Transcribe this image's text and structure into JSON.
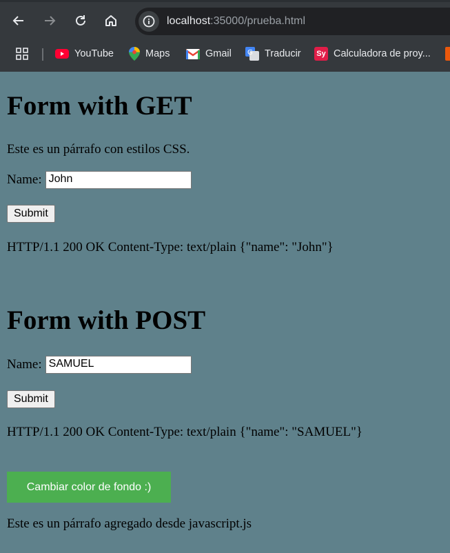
{
  "browser": {
    "url_host": "localhost",
    "url_path": ":35000/prueba.html",
    "bookmarks": [
      {
        "label": "YouTube",
        "icon": "youtube-icon"
      },
      {
        "label": "Maps",
        "icon": "maps-icon"
      },
      {
        "label": "Gmail",
        "icon": "gmail-icon"
      },
      {
        "label": "Traducir",
        "icon": "translate-icon"
      },
      {
        "label": "Calculadora de proy...",
        "icon": "sy-icon",
        "icon_text": "Sy"
      }
    ]
  },
  "page": {
    "get_form": {
      "title": "Form with GET",
      "paragraph": "Este es un párrafo con estilos CSS.",
      "name_label": "Name:",
      "name_value": "John",
      "submit_label": "Submit",
      "response": "HTTP/1.1 200 OK Content-Type: text/plain {\"name\": \"John\"}"
    },
    "post_form": {
      "title": "Form with POST",
      "name_label": "Name:",
      "name_value": "SAMUEL",
      "submit_label": "Submit",
      "response": "HTTP/1.1 200 OK Content-Type: text/plain {\"name\": \"SAMUEL\"}"
    },
    "change_bg_button": "Cambiar color de fondo :)",
    "js_paragraph": "Este es un párrafo agregado desde javascript.js"
  },
  "colors": {
    "page_background": "#5f818b",
    "button_green": "#4caf50",
    "chrome_dark": "#35393d"
  }
}
